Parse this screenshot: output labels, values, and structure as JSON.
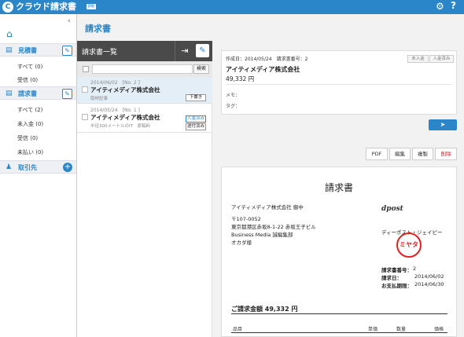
{
  "app": {
    "logo_letter": "C",
    "title": "クラウド請求書",
    "beta": "β版"
  },
  "topbar": {
    "settings_icon": "gear-icon",
    "help_icon": "help-icon",
    "help_glyph": "?"
  },
  "sidebar": {
    "collapse_glyph": "‹",
    "sections": [
      {
        "label": "見積書",
        "items": [
          "すべて (0)",
          "受信 (0)"
        ]
      },
      {
        "label": "請求書",
        "items": [
          "すべて (2)",
          "未入金 (0)",
          "受信 (0)",
          "未払い (0)"
        ]
      },
      {
        "label": "取引先",
        "items": []
      }
    ]
  },
  "main": {
    "title": "請求書"
  },
  "list": {
    "title": "請求書一覧",
    "search_button": "検索",
    "invoices": [
      {
        "date": "2014/06/02",
        "number": "[No. 2 ]",
        "client": "アイティメディア株式会社",
        "subject": "取材記事",
        "statuses": [
          "下書き"
        ]
      },
      {
        "date": "2014/05/24",
        "number": "[No. 1 ]",
        "client": "アイティメディア株式会社",
        "subject": "半径300メートルのIT　原稿料",
        "statuses": [
          "入金済み",
          "送付済み"
        ]
      }
    ]
  },
  "detail": {
    "created_label": "作成日：",
    "created": "2014/05/24",
    "number_label": "請求書番号：",
    "number": "2",
    "tabs": [
      "未入金",
      "入金済み"
    ],
    "client": "アイティメディア株式会社",
    "amount": "49,332 円",
    "memo_label": "メモ：",
    "tag_label": "タグ："
  },
  "actions": [
    "PDF",
    "編集",
    "複製",
    "削除"
  ],
  "doc": {
    "title": "請求書",
    "to": "アイティメディア株式会社 御中",
    "zip": "〒107-0052",
    "address": "東京都港区赤坂8-1-22 赤坂王子ビル",
    "dept": "Business Media 誠編集部",
    "person": "オカダ様",
    "issuer_logo": "dpost",
    "issuer": "ディーポスト・ジェイピー",
    "stamp": "ミヤタ",
    "num_label": "請求書番号：",
    "num": "2",
    "date_label": "請求日：",
    "date": "2014/06/02",
    "due_label": "お支払期限：",
    "due": "2014/06/30",
    "total": "ご請求金額 49,332 円",
    "columns": [
      "品目",
      "単価",
      "数量",
      "価格"
    ]
  },
  "colors": {
    "accent": "#2b86c9",
    "danger": "#d22222",
    "header_dark": "#4a4a4a"
  }
}
